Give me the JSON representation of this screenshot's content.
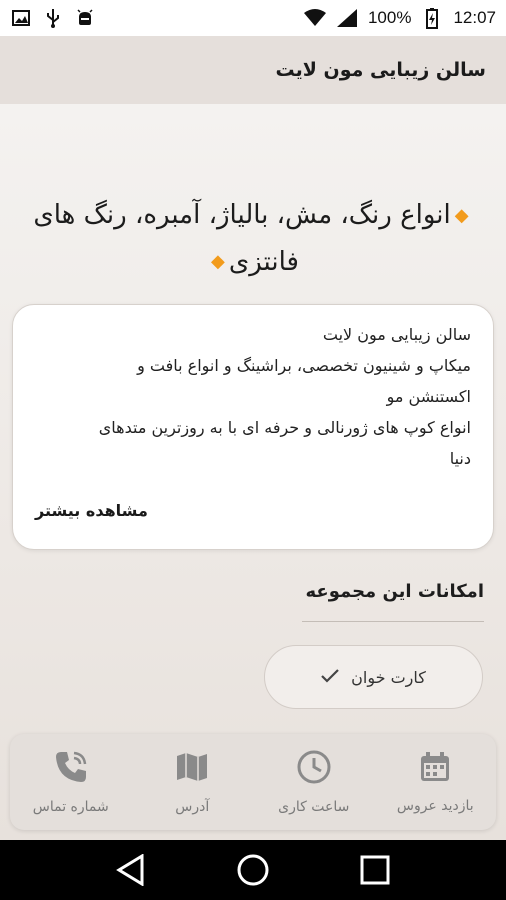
{
  "status_bar": {
    "battery": "100%",
    "time": "12:07"
  },
  "app_bar": {
    "title": "سالن زیبایی مون لایت"
  },
  "headline": {
    "line1": "انواع رنگ، مش، بالیاژ، آمبره، رنگ های",
    "line2": "فانتزی"
  },
  "description_card": {
    "lines": [
      "سالن زیبایی مون لایت",
      "میکاپ و شینیون تخصصی، براشینگ و انواع بافت و",
      "اکستنشن مو",
      "انواع کوپ های ژورنالی و حرفه ای با به روزترین متدهای",
      "دنیا"
    ],
    "more_label": "مشاهده بیشتر"
  },
  "facilities": {
    "title": "امکانات این مجموعه",
    "items": [
      {
        "label": "کارت خوان",
        "icon": "check-icon"
      }
    ]
  },
  "bottom_nav": {
    "items": [
      {
        "label": "بازدید عروس",
        "icon": "calendar-icon"
      },
      {
        "label": "ساعت کاری",
        "icon": "clock-icon"
      },
      {
        "label": "آدرس",
        "icon": "map-icon"
      },
      {
        "label": "شماره تماس",
        "icon": "phone-icon"
      }
    ]
  },
  "colors": {
    "accent": "#f29b1c",
    "app_bar": "#e5dfdb",
    "background": "#ebe6e2",
    "nav_icon": "#8a8a8a"
  }
}
